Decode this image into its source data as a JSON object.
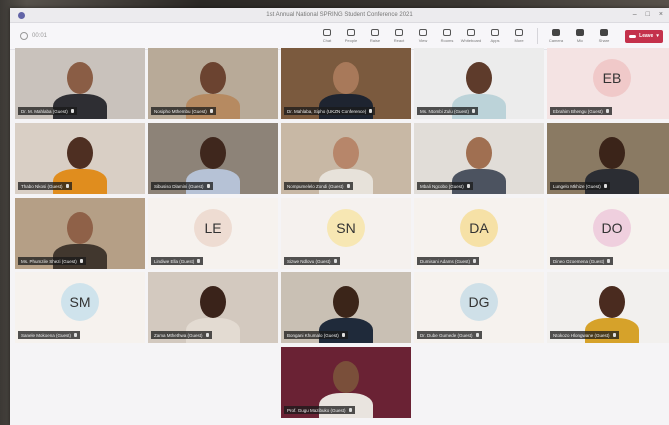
{
  "window": {
    "title": "1st Annual National SPRING Student Conference 2021"
  },
  "toolbar": {
    "timer": "00:01",
    "tools": [
      {
        "label": "Chat",
        "icon": "chat-icon"
      },
      {
        "label": "People",
        "icon": "people-icon"
      },
      {
        "label": "Raise",
        "icon": "raise-hand-icon"
      },
      {
        "label": "React",
        "icon": "react-icon"
      },
      {
        "label": "View",
        "icon": "view-icon"
      },
      {
        "label": "Rooms",
        "icon": "rooms-icon"
      },
      {
        "label": "Whiteboard",
        "icon": "whiteboard-icon"
      },
      {
        "label": "Apps",
        "icon": "apps-icon"
      },
      {
        "label": "More",
        "icon": "more-icon"
      }
    ],
    "media": [
      {
        "label": "Camera",
        "icon": "camera-icon"
      },
      {
        "label": "Mic",
        "icon": "mic-icon"
      },
      {
        "label": "Share",
        "icon": "share-icon"
      }
    ],
    "leave_label": "Leave"
  },
  "participants": [
    {
      "name": "Dr. M. Mahlaba (Guest)",
      "initials": "",
      "bg": "#c9c2bc",
      "skin": "#8a5d45",
      "shirt": "#2e2e33"
    },
    {
      "name": "Nosipho Mthembu (Guest)",
      "initials": "",
      "bg": "#b8aa98",
      "skin": "#6b4330",
      "shirt": "#b68a61"
    },
    {
      "name": "Dr. Mahlaba, Sipho (UKZN Conference)",
      "initials": "",
      "bg": "#7b5a3e",
      "skin": "#a8795a",
      "shirt": "#1e2430"
    },
    {
      "name": "Ms. Ntombi Zulu (Guest)",
      "initials": "",
      "bg": "#ececec",
      "skin": "#5e3b2b",
      "shirt": "#bcd3d9"
    },
    {
      "name": "Ebrahim Bhengu (Guest)",
      "initials": "EB",
      "bg": "#f4e3e3",
      "avatar": "#f0c9c9"
    },
    {
      "name": "Thabo Nkosi (Guest)",
      "initials": "",
      "bg": "#d9cfc5",
      "skin": "#4e2f22",
      "shirt": "#e08d1e"
    },
    {
      "name": "Sibusiso Dlamini (Guest)",
      "initials": "",
      "bg": "#8d8378",
      "skin": "#3f271d",
      "shirt": "#b6c2d6"
    },
    {
      "name": "Nompumelelo Zondi (Guest)",
      "initials": "",
      "bg": "#c8b8a5",
      "skin": "#b7866a",
      "shirt": "#e7e2da"
    },
    {
      "name": "Mbali Ngcobo (Guest)",
      "initials": "",
      "bg": "#e1ddd8",
      "skin": "#a06f51",
      "shirt": "#4c5360"
    },
    {
      "name": "Lungelo Mkhize (Guest)",
      "initials": "",
      "bg": "#8a7a63",
      "skin": "#3b2419",
      "shirt": "#2b2d33"
    },
    {
      "name": "Ms. Phumzile Shezi (Guest)",
      "initials": "",
      "bg": "#b59f86",
      "skin": "#8f6148",
      "shirt": "#41372e"
    },
    {
      "name": "Lindiwe Ella (Guest)",
      "initials": "LE",
      "bg": "#f6f2ee",
      "avatar": "#eedcd2"
    },
    {
      "name": "Sizwe Ndlovu (Guest)",
      "initials": "SN",
      "bg": "#f5f1ee",
      "avatar": "#f7e7b3"
    },
    {
      "name": "Dumisani Adams (Guest)",
      "initials": "DA",
      "bg": "#f6f2ee",
      "avatar": "#f6e1a6"
    },
    {
      "name": "Dineo Ozoemena (Guest)",
      "initials": "DO",
      "bg": "#f6f2ee",
      "avatar": "#efcfde"
    },
    {
      "name": "Sanele Mokoena (Guest)",
      "initials": "SM",
      "bg": "#f6f2ee",
      "avatar": "#cfe3ec"
    },
    {
      "name": "Zama Mthethwa (Guest)",
      "initials": "",
      "bg": "#d3c9bf",
      "skin": "#3a231a",
      "shirt": "#e3dbd2"
    },
    {
      "name": "Bongani Khumalo (Guest)",
      "initials": "",
      "bg": "#c9c0b4",
      "skin": "#3b2519",
      "shirt": "#1f2a3a"
    },
    {
      "name": "Dr. Dube Gumede (Guest)",
      "initials": "DG",
      "bg": "#f6f2ee",
      "avatar": "#cfe0e8"
    },
    {
      "name": "Ntokozo Hlongwane (Guest)",
      "initials": "",
      "bg": "#f2f0ee",
      "skin": "#4a2b1f",
      "shirt": "#d6a22a"
    },
    {
      "name": "Prof. Gugu Mazibuko (Guest)",
      "initials": "",
      "bg": "#6a2234",
      "skin": "#7a4f3a",
      "shirt": "#e9e4df"
    }
  ]
}
